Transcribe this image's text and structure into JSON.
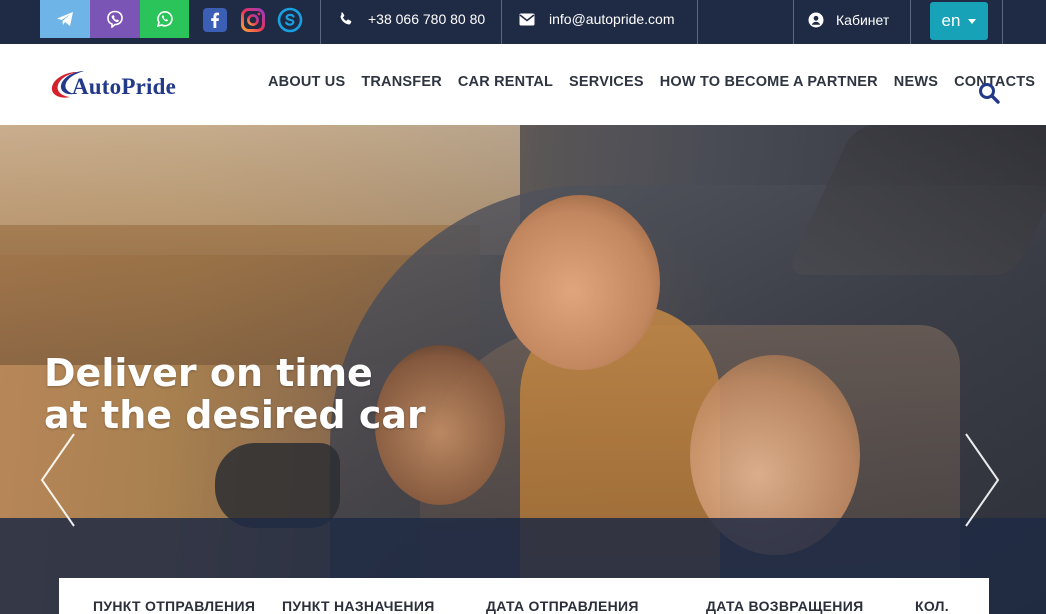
{
  "topbar": {
    "phone": "+38 066 780 80 80",
    "email": "info@autopride.com",
    "cabinet_label": "Кабинет",
    "language": "en",
    "social_icons": [
      "telegram-icon",
      "viber-icon",
      "whatsapp-icon",
      "facebook-icon",
      "instagram-icon",
      "skype-icon"
    ]
  },
  "header": {
    "logo_text": "AutoPride",
    "nav": [
      "ABOUT US",
      "TRANSFER",
      "CAR RENTAL",
      "SERVICES",
      "HOW TO BECOME A PARTNER",
      "NEWS",
      "CONTACTS"
    ]
  },
  "hero": {
    "title_line1": "Deliver on time",
    "title_line2": "at the desired car"
  },
  "booking": {
    "labels": [
      "ПУНКТ ОТПРАВЛЕНИЯ",
      "ПУНКТ НАЗНАЧЕНИЯ",
      "ДАТА ОТПРАВЛЕНИЯ",
      "ДАТА ВОЗВРАЩЕНИЯ",
      "КОЛ."
    ]
  },
  "colors": {
    "topbar_bg": "#1f2a44",
    "telegram": "#6fb4e6",
    "viber": "#7b55b5",
    "whatsapp": "#2bc45a",
    "lang_button": "#17a2b8",
    "brand_blue": "#233a8a",
    "brand_red": "#d3202a"
  }
}
